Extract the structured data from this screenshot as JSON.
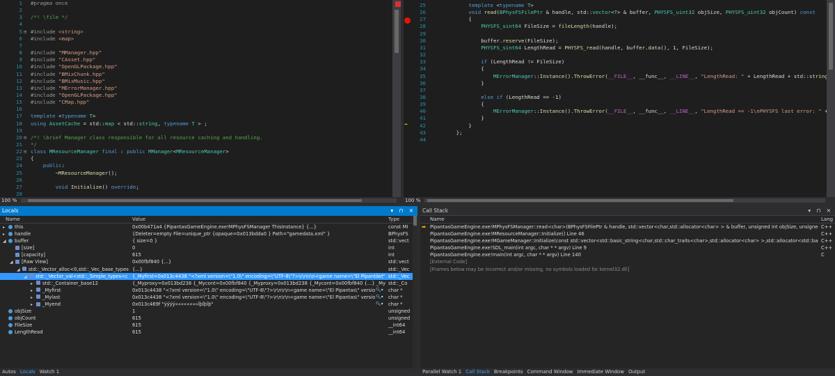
{
  "editor_left": {
    "lines": [
      {
        "n": "1",
        "fold": "",
        "segs": [
          [
            "pp",
            "#pragma once"
          ]
        ]
      },
      {
        "n": "2",
        "fold": "",
        "segs": []
      },
      {
        "n": "3",
        "fold": "",
        "segs": [
          [
            "cm",
            "/*! \\file */"
          ]
        ]
      },
      {
        "n": "4",
        "fold": "",
        "segs": []
      },
      {
        "n": "5",
        "fold": "⊟",
        "segs": [
          [
            "pp",
            "#include "
          ],
          [
            "str",
            "<string>"
          ]
        ]
      },
      {
        "n": "6",
        "fold": "",
        "segs": [
          [
            "pp",
            "#include "
          ],
          [
            "str",
            "<map>"
          ]
        ]
      },
      {
        "n": "7",
        "fold": "",
        "segs": []
      },
      {
        "n": "8",
        "fold": "",
        "segs": [
          [
            "pp",
            "#include "
          ],
          [
            "str",
            "\"MManager.hpp\""
          ]
        ]
      },
      {
        "n": "9",
        "fold": "",
        "segs": [
          [
            "pp",
            "#include "
          ],
          [
            "str",
            "\"CAsset.hpp\""
          ]
        ]
      },
      {
        "n": "10",
        "fold": "",
        "segs": [
          [
            "pp",
            "#include "
          ],
          [
            "str",
            "\"OpenGLPackage.hpp\""
          ]
        ]
      },
      {
        "n": "11",
        "fold": "",
        "segs": [
          [
            "pp",
            "#include "
          ],
          [
            "str",
            "\"BMixChunk.hpp\""
          ]
        ]
      },
      {
        "n": "12",
        "fold": "",
        "segs": [
          [
            "pp",
            "#include "
          ],
          [
            "str",
            "\"BMixMusic.hpp\""
          ]
        ]
      },
      {
        "n": "13",
        "fold": "",
        "segs": [
          [
            "pp",
            "#include "
          ],
          [
            "str",
            "\"MErrorManager.hpp\""
          ]
        ]
      },
      {
        "n": "14",
        "fold": "",
        "segs": [
          [
            "pp",
            "#include "
          ],
          [
            "str",
            "\"OpenGLPackage.hpp\""
          ]
        ]
      },
      {
        "n": "15",
        "fold": "",
        "segs": [
          [
            "pp",
            "#include "
          ],
          [
            "str",
            "\"CMap.hpp\""
          ]
        ]
      },
      {
        "n": "16",
        "fold": "",
        "segs": []
      },
      {
        "n": "17",
        "fold": "",
        "segs": [
          [
            "kw",
            "template "
          ],
          [
            "tx",
            "<"
          ],
          [
            "kw",
            "typename "
          ],
          [
            "ty",
            "T"
          ],
          [
            "tx",
            ">"
          ]
        ]
      },
      {
        "n": "18",
        "fold": "",
        "segs": [
          [
            "kw",
            "using "
          ],
          [
            "ty",
            "AssetCache"
          ],
          [
            "tx",
            " = std::"
          ],
          [
            "ty",
            "map"
          ],
          [
            "tx",
            " < std::"
          ],
          [
            "ty",
            "string"
          ],
          [
            "tx",
            ", "
          ],
          [
            "kw",
            "typename "
          ],
          [
            "ty",
            "T"
          ],
          [
            "tx",
            " > ;"
          ]
        ]
      },
      {
        "n": "19",
        "fold": "",
        "segs": []
      },
      {
        "n": "20",
        "fold": "⊟",
        "segs": [
          [
            "cm",
            "/*! \\brief Manager class responsible for all resource caching and handling."
          ]
        ]
      },
      {
        "n": "21",
        "fold": "",
        "segs": [
          [
            "cm",
            "*/"
          ]
        ]
      },
      {
        "n": "22",
        "fold": "⊟",
        "segs": [
          [
            "kw",
            "class "
          ],
          [
            "ty",
            "MResourceManager"
          ],
          [
            "kw",
            " final"
          ],
          [
            "tx",
            " : "
          ],
          [
            "kw",
            "public "
          ],
          [
            "ty",
            "MManager"
          ],
          [
            "tx",
            "<"
          ],
          [
            "ty",
            "MResourceManager"
          ],
          [
            "tx",
            ">"
          ]
        ]
      },
      {
        "n": "23",
        "fold": "",
        "segs": [
          [
            "tx",
            "{"
          ]
        ]
      },
      {
        "n": "24",
        "fold": "",
        "segs": [
          [
            "kw",
            "    public"
          ],
          [
            "tx",
            ":"
          ]
        ]
      },
      {
        "n": "25",
        "fold": "",
        "segs": [
          [
            "tx",
            "        ~"
          ],
          [
            "fn",
            "MResourceManager"
          ],
          [
            "tx",
            "();"
          ]
        ]
      },
      {
        "n": "26",
        "fold": "",
        "segs": []
      },
      {
        "n": "27",
        "fold": "",
        "segs": [
          [
            "kw",
            "        void "
          ],
          [
            "fn",
            "Initialize"
          ],
          [
            "tx",
            "() "
          ],
          [
            "kw",
            "override"
          ],
          [
            "tx",
            ";"
          ]
        ]
      },
      {
        "n": "28",
        "fold": "",
        "segs": []
      }
    ],
    "zoom": "100 %"
  },
  "editor_right": {
    "lines": [
      {
        "n": "25",
        "segs": [
          [
            "kw",
            "            template "
          ],
          [
            "tx",
            "<"
          ],
          [
            "kw",
            "typename "
          ],
          [
            "ty",
            "T"
          ],
          [
            "tx",
            ">"
          ]
        ]
      },
      {
        "n": "26",
        "segs": [
          [
            "kw",
            "            void "
          ],
          [
            "fn",
            "read"
          ],
          [
            "tx",
            "("
          ],
          [
            "ty",
            "BPhysFSFilePtr"
          ],
          [
            "tx",
            " & handle, std::"
          ],
          [
            "ty",
            "vector"
          ],
          [
            "tx",
            "<"
          ],
          [
            "ty",
            "T"
          ],
          [
            "tx",
            "> & buffer, "
          ],
          [
            "ty",
            "PHYSFS_uint32"
          ],
          [
            "tx",
            " objSize, "
          ],
          [
            "ty",
            "PHYSFS_uint32"
          ],
          [
            "tx",
            " objCount) "
          ],
          [
            "kw",
            "const"
          ]
        ]
      },
      {
        "n": "27",
        "segs": [
          [
            "tx",
            "            {"
          ]
        ]
      },
      {
        "n": "28",
        "segs": [
          [
            "ty",
            "                PHYSFS_sint64"
          ],
          [
            "tx",
            " FileSize = "
          ],
          [
            "fn",
            "fileLength"
          ],
          [
            "tx",
            "(handle);"
          ]
        ]
      },
      {
        "n": "29",
        "segs": []
      },
      {
        "n": "30",
        "segs": [
          [
            "tx",
            "                buffer."
          ],
          [
            "fn",
            "reserve"
          ],
          [
            "tx",
            "(FileSize);"
          ]
        ]
      },
      {
        "n": "31",
        "segs": [
          [
            "ty",
            "                PHYSFS_sint64"
          ],
          [
            "tx",
            " LengthRead = "
          ],
          [
            "fn",
            "PHYSFS_read"
          ],
          [
            "tx",
            "(handle, buffer."
          ],
          [
            "fn",
            "data"
          ],
          [
            "tx",
            "(), 1, FileSize);"
          ]
        ]
      },
      {
        "n": "32",
        "segs": []
      },
      {
        "n": "33",
        "segs": [
          [
            "kw",
            "                if "
          ],
          [
            "tx",
            "(LengthRead != FileSize)"
          ]
        ]
      },
      {
        "n": "34",
        "segs": [
          [
            "tx",
            "                {"
          ]
        ]
      },
      {
        "n": "35",
        "segs": [
          [
            "ty",
            "                    MErrorManager"
          ],
          [
            "tx",
            "::"
          ],
          [
            "fn",
            "Instance"
          ],
          [
            "tx",
            "()."
          ],
          [
            "fn",
            "ThrowError"
          ],
          [
            "tx",
            "("
          ],
          [
            "mac",
            "__FILE__"
          ],
          [
            "tx",
            ", __func__, "
          ],
          [
            "mac",
            "__LINE__"
          ],
          [
            "tx",
            ", "
          ],
          [
            "str",
            "\"LengthRead: \""
          ],
          [
            "tx",
            " + LengthRead + std::"
          ],
          [
            "fn",
            "string"
          ],
          [
            "tx",
            "("
          ],
          [
            "str",
            "\"\\nFi"
          ]
        ]
      },
      {
        "n": "36",
        "segs": [
          [
            "tx",
            "                }"
          ]
        ]
      },
      {
        "n": "37",
        "segs": []
      },
      {
        "n": "38",
        "segs": [
          [
            "kw",
            "                else if "
          ],
          [
            "tx",
            "(LengthRead == -1)"
          ]
        ]
      },
      {
        "n": "39",
        "segs": [
          [
            "tx",
            "                {"
          ]
        ]
      },
      {
        "n": "40",
        "segs": [
          [
            "ty",
            "                    MErrorManager"
          ],
          [
            "tx",
            "::"
          ],
          [
            "fn",
            "Instance"
          ],
          [
            "tx",
            "()."
          ],
          [
            "fn",
            "ThrowError"
          ],
          [
            "tx",
            "("
          ],
          [
            "mac",
            "__FILE__"
          ],
          [
            "tx",
            ", __func__, "
          ],
          [
            "mac",
            "__LINE__"
          ],
          [
            "tx",
            ", "
          ],
          [
            "str",
            "\"LengthRead == -1\\nPHYSFS last error: \""
          ],
          [
            "tx",
            " + std::"
          ],
          [
            "fn",
            "strin"
          ]
        ]
      },
      {
        "n": "41",
        "segs": [
          [
            "tx",
            "                }"
          ]
        ]
      },
      {
        "n": "42",
        "segs": [
          [
            "tx",
            "            }"
          ]
        ]
      },
      {
        "n": "43",
        "segs": [
          [
            "tx",
            "        };"
          ]
        ]
      },
      {
        "n": "44",
        "segs": []
      }
    ],
    "zoom": "100 %"
  },
  "locals": {
    "title": "Locals",
    "title_buttons": "▾ ⊓ ✕",
    "headers": {
      "name": "Name",
      "value": "Value",
      "type": "Type"
    },
    "rows": [
      {
        "indent": 0,
        "exp": "▸",
        "icon": "var",
        "name": "this",
        "value": "0x00b471a4 {PipantasGameEngine.exe!MPhysFSManager ThisInstance} {...}",
        "type": "const MI",
        "selected": false
      },
      {
        "indent": 0,
        "exp": "▸",
        "icon": "var",
        "name": "handle",
        "value": "{Deleter=empty File=unique_ptr {opaque=0x013bdda0 } Path=\"gamedata.xml\" }",
        "type": "BPhysFS",
        "selected": false
      },
      {
        "indent": 0,
        "exp": "◢",
        "icon": "var",
        "name": "buffer",
        "value": "{ size=0 }",
        "type": "std::vect",
        "selected": false
      },
      {
        "indent": 1,
        "exp": "",
        "icon": "member",
        "name": "[size]",
        "value": "0",
        "type": "int",
        "selected": false
      },
      {
        "indent": 1,
        "exp": "",
        "icon": "member",
        "name": "[capacity]",
        "value": "615",
        "type": "int",
        "selected": false
      },
      {
        "indent": 1,
        "exp": "◢",
        "icon": "member",
        "name": "[Raw View]",
        "value": "0x00fbf840 {...}",
        "type": "std::vect",
        "selected": false
      },
      {
        "indent": 2,
        "exp": "◢",
        "icon": "member",
        "name": "std::_Vector_alloc<0,std::_Vec_base_types<c",
        "value": "{...}",
        "type": "std::_Vec",
        "selected": false
      },
      {
        "indent": 3,
        "exp": "◢",
        "icon": "member",
        "name": "std::_Vector_val<std::_Simple_types<c",
        "value": "{_Myfirst=0x013c4438 \"<?xml version=\\\"1.0\\\" encoding=\\\"UTF-8\\\"?>\\r\\n\\r\\n<game name=\\\"El Pipantas\\\" ve",
        "type": "std::_Vec",
        "selected": true
      },
      {
        "indent": 4,
        "exp": "▸",
        "icon": "member",
        "name": "std::_Container_base12",
        "value": "{_Myproxy=0x013bd238 {_Mycont=0x00fbf840 {_Myproxy=0x013bd238 {_Mycont=0x00fbf840 {...} _Myfirstiter=",
        "type": "std::_Co",
        "selected": false
      },
      {
        "indent": 4,
        "exp": "▸",
        "icon": "member",
        "name": "_Myfirst",
        "value": "0x013c4438 \"<?xml version=\\\"1.0\\\" encoding=\\\"UTF-8\\\"?>\\r\\n\\r\\n<game name=\\\"El Pipantas\\\" versio",
        "type": "char *",
        "selected": false
      },
      {
        "indent": 4,
        "exp": "▸",
        "icon": "member",
        "name": "_Mylast",
        "value": "0x013c4438 \"<?xml version=\\\"1.0\\\" encoding=\\\"UTF-8\\\"?>\\r\\n\\r\\n<game name=\\\"El Pipantas\\\" versio",
        "type": "char *",
        "selected": false
      },
      {
        "indent": 4,
        "exp": "▸",
        "icon": "member",
        "name": "_Myend",
        "value": "0x013c469f \"ýýýý««««««««îþîþîþ\"",
        "type": "char *",
        "selected": false
      },
      {
        "indent": 0,
        "exp": "",
        "icon": "var",
        "name": "objSize",
        "value": "1",
        "type": "unsigned",
        "selected": false
      },
      {
        "indent": 0,
        "exp": "",
        "icon": "var",
        "name": "objCount",
        "value": "615",
        "type": "unsigned",
        "selected": false
      },
      {
        "indent": 0,
        "exp": "",
        "icon": "var",
        "name": "FileSize",
        "value": "615",
        "type": "__int64",
        "selected": false
      },
      {
        "indent": 0,
        "exp": "",
        "icon": "var",
        "name": "LengthRead",
        "value": "615",
        "type": "__int64",
        "selected": false
      }
    ],
    "tabs": [
      {
        "label": "Autos",
        "active": false
      },
      {
        "label": "Locals",
        "active": true
      },
      {
        "label": "Watch 1",
        "active": false
      }
    ]
  },
  "callstack": {
    "title": "Call Stack",
    "title_buttons": "▾ ⊓ ✕",
    "headers": {
      "name": "Name",
      "lang": "Lang"
    },
    "rows": [
      {
        "current": true,
        "grey": false,
        "name": "PipantasGameEngine.exe!MPhysFSManager::read<char>(BPhysFSFilePtr & handle, std::vector<char,std::allocator<char> > & buffer, unsigned int objSize, unsigned int c",
        "lang": "C++"
      },
      {
        "current": false,
        "grey": false,
        "name": "PipantasGameEngine.exe!MResourceManager::Initialize() Line 46",
        "lang": "C++"
      },
      {
        "current": false,
        "grey": false,
        "name": "PipantasGameEngine.exe!MGameManager::Initialize(const std::vector<std::basic_string<char,std::char_traits<char>,std::allocator<char> >,std::allocator<std::basic_strin",
        "lang": "C++"
      },
      {
        "current": false,
        "grey": false,
        "name": "PipantasGameEngine.exe!SDL_main(int argc, char * * argv) Line 9",
        "lang": "C++"
      },
      {
        "current": false,
        "grey": false,
        "name": "PipantasGameEngine.exe!main(int argc, char * * argv) Line 140",
        "lang": "C"
      },
      {
        "current": false,
        "grey": true,
        "name": "[External Code]",
        "lang": ""
      },
      {
        "current": false,
        "grey": true,
        "name": "[Frames below may be incorrect and/or missing, no symbols loaded for kernel32.dll]",
        "lang": ""
      }
    ],
    "tabs": [
      {
        "label": "Parallel Watch 1",
        "active": false
      },
      {
        "label": "Call Stack",
        "active": true
      },
      {
        "label": "Breakpoints",
        "active": false
      },
      {
        "label": "Command Window",
        "active": false
      },
      {
        "label": "Immediate Window",
        "active": false
      },
      {
        "label": "Output",
        "active": false
      }
    ]
  }
}
